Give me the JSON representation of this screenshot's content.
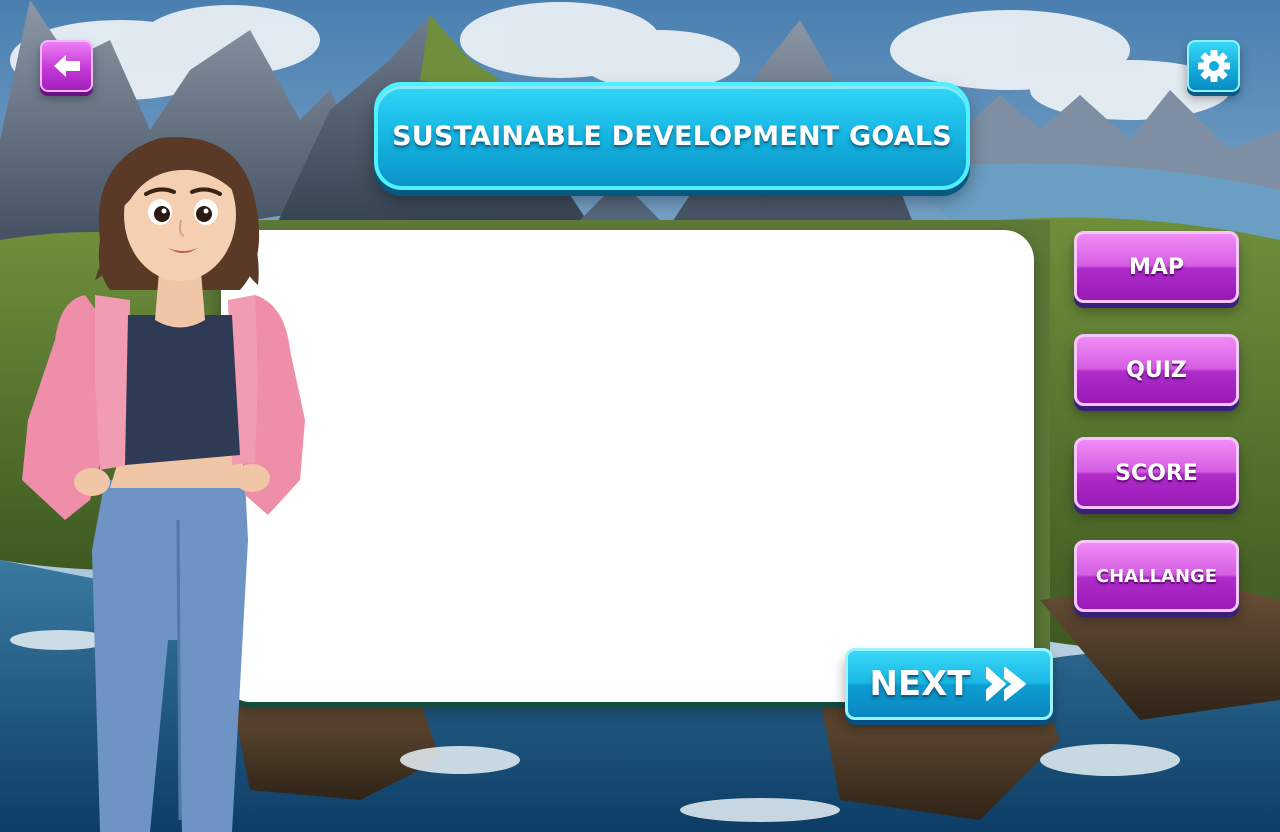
{
  "header": {
    "title": "SUSTAINABLE DEVELOPMENT GOALS",
    "back_icon": "arrow-left-icon",
    "settings_icon": "gear-icon"
  },
  "menu": {
    "map_label": "MAP",
    "quiz_label": "QUIZ",
    "score_label": "SCORE",
    "challange_label": "CHALLANGE"
  },
  "footer": {
    "next_label": "NEXT",
    "next_icon": "double-chevron-right-icon"
  },
  "colors": {
    "accent_cyan": "#1ab8e4",
    "accent_magenta": "#c43ad6",
    "panel": "#ffffff"
  }
}
